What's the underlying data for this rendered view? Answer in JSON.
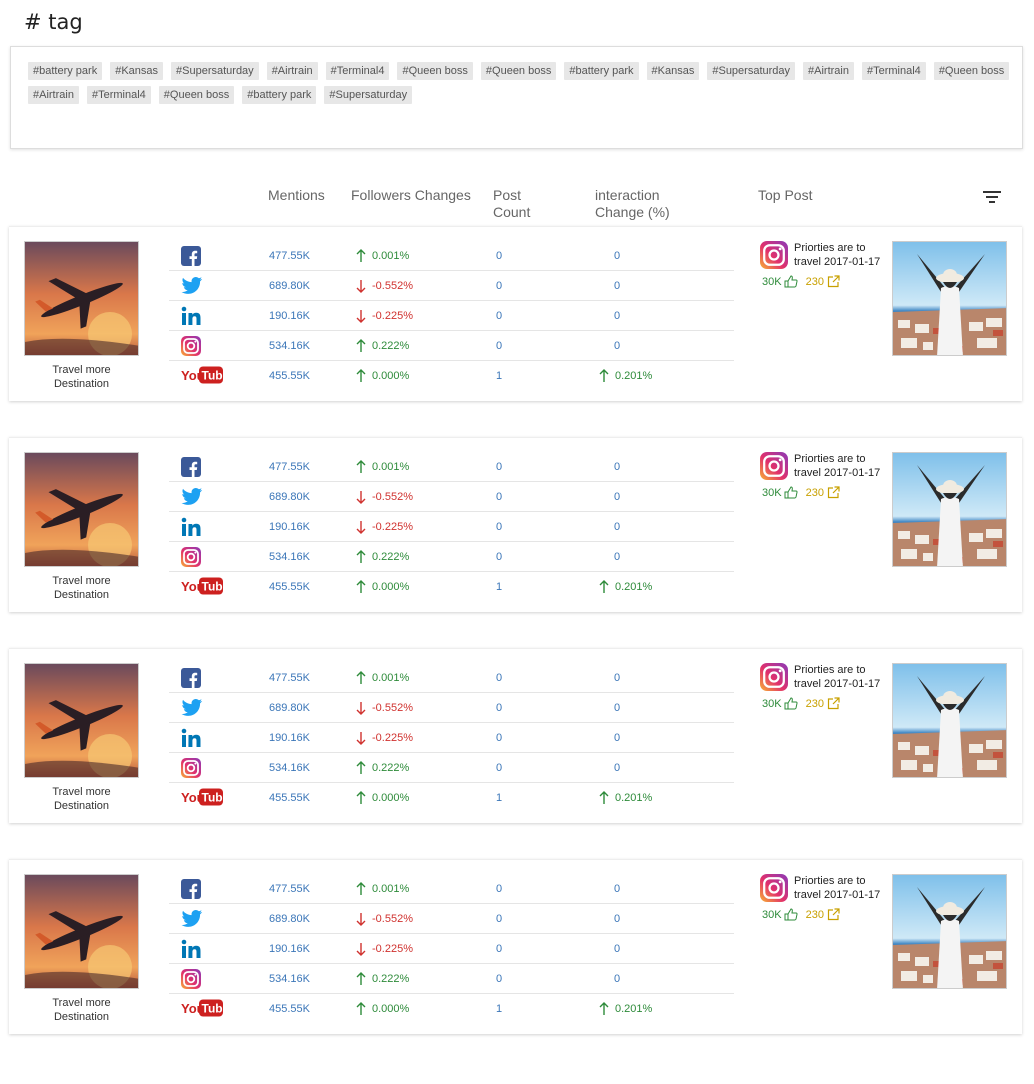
{
  "page": {
    "title": "# tag"
  },
  "tags": [
    "#battery park",
    "#Kansas",
    "#Supersaturday",
    "#Airtrain",
    "#Terminal4",
    "#Queen boss",
    "#Queen boss",
    "#battery park",
    "#Kansas",
    "#Supersaturday",
    "#Airtrain",
    "#Terminal4",
    "#Queen boss",
    "#Airtrain",
    "#Terminal4",
    "#Queen boss",
    "#battery park",
    "#Supersaturday"
  ],
  "columns": {
    "mentions": "Mentions",
    "followers": "Followers Changes",
    "post_count_1": "Post",
    "post_count_2": "Count",
    "interaction_1": "interaction",
    "interaction_2": "Change (%)",
    "top_post": "Top Post"
  },
  "colors": {
    "positive": "#2e8b3a",
    "negative": "#d0322f",
    "link": "#3b76b8",
    "shares": "#c8a000"
  },
  "cards": [
    {
      "caption_1": "Travel more",
      "caption_2": "Destination",
      "rows": [
        {
          "network": "facebook-icon",
          "mentions": "477.55K",
          "dir": "up",
          "change": "0.001%",
          "posts": "0",
          "interaction": "0"
        },
        {
          "network": "twitter-icon",
          "mentions": "689.80K",
          "dir": "down",
          "change": "-0.552%",
          "posts": "0",
          "interaction": "0"
        },
        {
          "network": "linkedin-icon",
          "mentions": "190.16K",
          "dir": "down",
          "change": "-0.225%",
          "posts": "0",
          "interaction": "0"
        },
        {
          "network": "instagram-icon",
          "mentions": "534.16K",
          "dir": "up",
          "change": "0.222%",
          "posts": "0",
          "interaction": "0"
        },
        {
          "network": "youtube-icon",
          "mentions": "455.55K",
          "dir": "up",
          "change": "0.000%",
          "posts": "1",
          "interaction": "0.201%"
        }
      ],
      "top_post": {
        "text_1": "Priorties are to",
        "text_2": "travel 2017-01-17",
        "likes": "30K",
        "shares": "230"
      }
    },
    {
      "caption_1": "Travel more",
      "caption_2": "Destination",
      "rows": [
        {
          "network": "facebook-icon",
          "mentions": "477.55K",
          "dir": "up",
          "change": "0.001%",
          "posts": "0",
          "interaction": "0"
        },
        {
          "network": "twitter-icon",
          "mentions": "689.80K",
          "dir": "down",
          "change": "-0.552%",
          "posts": "0",
          "interaction": "0"
        },
        {
          "network": "linkedin-icon",
          "mentions": "190.16K",
          "dir": "down",
          "change": "-0.225%",
          "posts": "0",
          "interaction": "0"
        },
        {
          "network": "instagram-icon",
          "mentions": "534.16K",
          "dir": "up",
          "change": "0.222%",
          "posts": "0",
          "interaction": "0"
        },
        {
          "network": "youtube-icon",
          "mentions": "455.55K",
          "dir": "up",
          "change": "0.000%",
          "posts": "1",
          "interaction": "0.201%"
        }
      ],
      "top_post": {
        "text_1": "Priorties are to",
        "text_2": "travel 2017-01-17",
        "likes": "30K",
        "shares": "230"
      }
    },
    {
      "caption_1": "Travel more",
      "caption_2": "Destination",
      "rows": [
        {
          "network": "facebook-icon",
          "mentions": "477.55K",
          "dir": "up",
          "change": "0.001%",
          "posts": "0",
          "interaction": "0"
        },
        {
          "network": "twitter-icon",
          "mentions": "689.80K",
          "dir": "down",
          "change": "-0.552%",
          "posts": "0",
          "interaction": "0"
        },
        {
          "network": "linkedin-icon",
          "mentions": "190.16K",
          "dir": "down",
          "change": "-0.225%",
          "posts": "0",
          "interaction": "0"
        },
        {
          "network": "instagram-icon",
          "mentions": "534.16K",
          "dir": "up",
          "change": "0.222%",
          "posts": "0",
          "interaction": "0"
        },
        {
          "network": "youtube-icon",
          "mentions": "455.55K",
          "dir": "up",
          "change": "0.000%",
          "posts": "1",
          "interaction": "0.201%"
        }
      ],
      "top_post": {
        "text_1": "Priorties are to",
        "text_2": "travel 2017-01-17",
        "likes": "30K",
        "shares": "230"
      }
    },
    {
      "caption_1": "Travel more",
      "caption_2": "Destination",
      "rows": [
        {
          "network": "facebook-icon",
          "mentions": "477.55K",
          "dir": "up",
          "change": "0.001%",
          "posts": "0",
          "interaction": "0"
        },
        {
          "network": "twitter-icon",
          "mentions": "689.80K",
          "dir": "down",
          "change": "-0.552%",
          "posts": "0",
          "interaction": "0"
        },
        {
          "network": "linkedin-icon",
          "mentions": "190.16K",
          "dir": "down",
          "change": "-0.225%",
          "posts": "0",
          "interaction": "0"
        },
        {
          "network": "instagram-icon",
          "mentions": "534.16K",
          "dir": "up",
          "change": "0.222%",
          "posts": "0",
          "interaction": "0"
        },
        {
          "network": "youtube-icon",
          "mentions": "455.55K",
          "dir": "up",
          "change": "0.000%",
          "posts": "1",
          "interaction": "0.201%"
        }
      ],
      "top_post": {
        "text_1": "Priorties are to",
        "text_2": "travel 2017-01-17",
        "likes": "30K",
        "shares": "230"
      }
    }
  ]
}
